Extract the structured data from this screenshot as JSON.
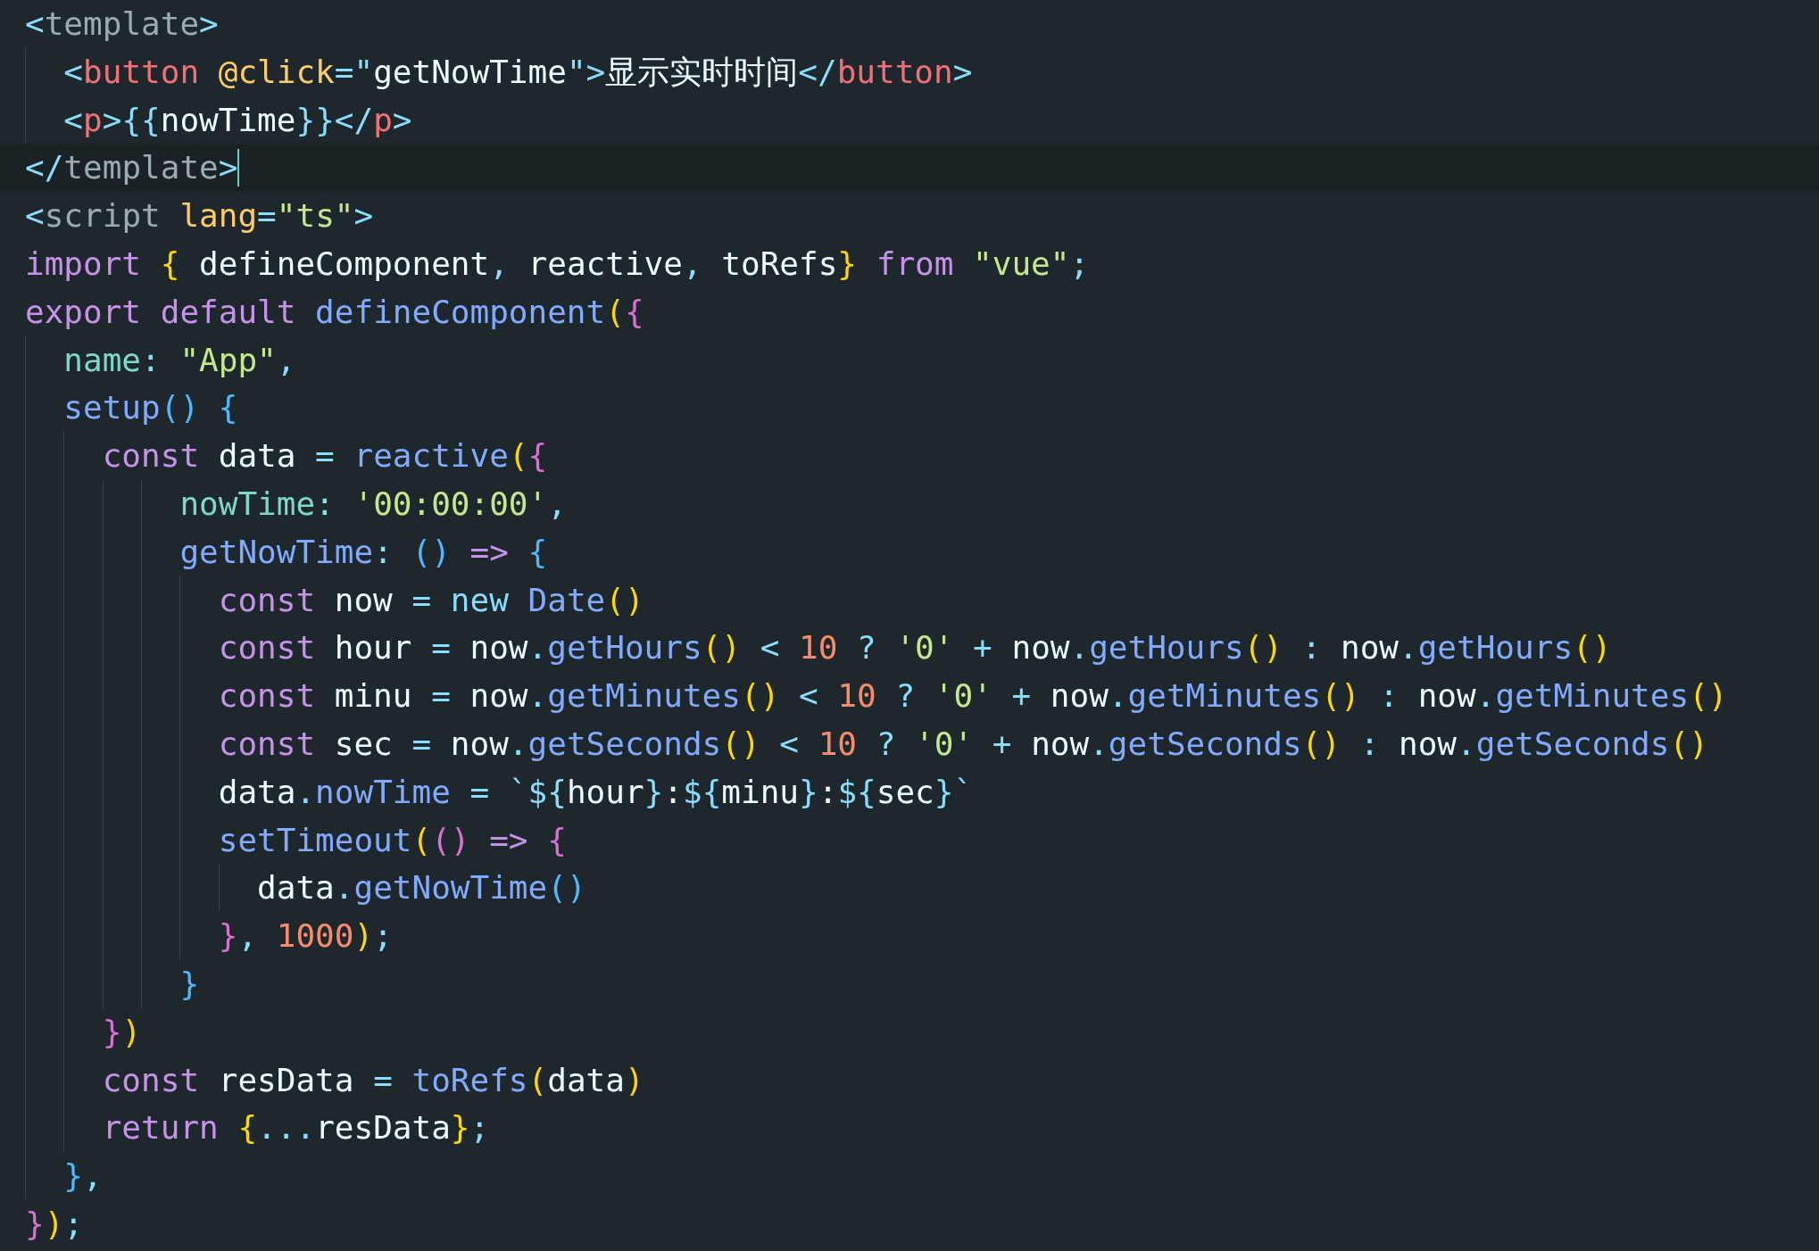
{
  "editor": {
    "lines": [
      {
        "current": false,
        "tokens": [
          {
            "text": "<",
            "kind": "p"
          },
          {
            "text": "template",
            "kind": "tagname"
          },
          {
            "text": ">",
            "kind": "p"
          }
        ]
      },
      {
        "current": false,
        "tokens": [
          {
            "text": "  <",
            "kind": "p"
          },
          {
            "text": "button",
            "kind": "tag"
          },
          {
            "text": " @click",
            "kind": "attr"
          },
          {
            "text": "=\"",
            "kind": "p"
          },
          {
            "text": "getNowTime",
            "kind": "txt"
          },
          {
            "text": "\">",
            "kind": "p"
          },
          {
            "text": "显示实时时间",
            "kind": "txt"
          },
          {
            "text": "</",
            "kind": "p"
          },
          {
            "text": "button",
            "kind": "tag"
          },
          {
            "text": ">",
            "kind": "p"
          }
        ]
      },
      {
        "current": false,
        "tokens": [
          {
            "text": "  <",
            "kind": "p"
          },
          {
            "text": "p",
            "kind": "tag"
          },
          {
            "text": ">{{",
            "kind": "p"
          },
          {
            "text": "nowTime",
            "kind": "txt"
          },
          {
            "text": "}}</",
            "kind": "p"
          },
          {
            "text": "p",
            "kind": "tag"
          },
          {
            "text": ">",
            "kind": "p"
          }
        ]
      },
      {
        "current": true,
        "tokens": [
          {
            "text": "</",
            "kind": "p"
          },
          {
            "text": "template",
            "kind": "tagname"
          },
          {
            "text": ">",
            "kind": "p"
          }
        ]
      },
      {
        "current": false,
        "tokens": [
          {
            "text": "<",
            "kind": "p"
          },
          {
            "text": "script",
            "kind": "tagname"
          },
          {
            "text": " lang",
            "kind": "attr"
          },
          {
            "text": "=",
            "kind": "p"
          },
          {
            "text": "\"ts\"",
            "kind": "str"
          },
          {
            "text": ">",
            "kind": "p"
          }
        ]
      },
      {
        "current": false,
        "tokens": [
          {
            "text": "import",
            "kind": "kw"
          },
          {
            "text": " {",
            "kind": "by"
          },
          {
            "text": " defineComponent",
            "kind": "txt"
          },
          {
            "text": ",",
            "kind": "p"
          },
          {
            "text": " reactive",
            "kind": "txt"
          },
          {
            "text": ",",
            "kind": "p"
          },
          {
            "text": " toRefs",
            "kind": "txt"
          },
          {
            "text": "}",
            "kind": "by"
          },
          {
            "text": " from",
            "kind": "kw"
          },
          {
            "text": " \"vue\"",
            "kind": "str"
          },
          {
            "text": ";",
            "kind": "p"
          }
        ]
      },
      {
        "current": false,
        "tokens": [
          {
            "text": "export default",
            "kind": "kw"
          },
          {
            "text": " defineComponent",
            "kind": "fn"
          },
          {
            "text": "(",
            "kind": "by"
          },
          {
            "text": "{",
            "kind": "bp"
          }
        ]
      },
      {
        "current": false,
        "tokens": [
          {
            "text": "  name",
            "kind": "prop"
          },
          {
            "text": ":",
            "kind": "p"
          },
          {
            "text": " \"App\"",
            "kind": "str"
          },
          {
            "text": ",",
            "kind": "p"
          }
        ]
      },
      {
        "current": false,
        "tokens": [
          {
            "text": "  setup",
            "kind": "fn"
          },
          {
            "text": "()",
            "kind": "bb"
          },
          {
            "text": " {",
            "kind": "bb"
          }
        ]
      },
      {
        "current": false,
        "tokens": [
          {
            "text": "    const",
            "kind": "kw"
          },
          {
            "text": " data ",
            "kind": "txt"
          },
          {
            "text": "=",
            "kind": "op"
          },
          {
            "text": " reactive",
            "kind": "fn"
          },
          {
            "text": "(",
            "kind": "by"
          },
          {
            "text": "{",
            "kind": "bp"
          }
        ]
      },
      {
        "current": false,
        "tokens": [
          {
            "text": "        nowTime",
            "kind": "prop"
          },
          {
            "text": ":",
            "kind": "p"
          },
          {
            "text": " '00:00:00'",
            "kind": "str"
          },
          {
            "text": ",",
            "kind": "p"
          }
        ]
      },
      {
        "current": false,
        "tokens": [
          {
            "text": "        getNowTime",
            "kind": "fn"
          },
          {
            "text": ":",
            "kind": "p"
          },
          {
            "text": " ()",
            "kind": "bb"
          },
          {
            "text": " =>",
            "kind": "kw"
          },
          {
            "text": " {",
            "kind": "bb"
          }
        ]
      },
      {
        "current": false,
        "tokens": [
          {
            "text": "          const",
            "kind": "kw"
          },
          {
            "text": " now ",
            "kind": "txt"
          },
          {
            "text": "=",
            "kind": "op"
          },
          {
            "text": " new",
            "kind": "op"
          },
          {
            "text": " Date",
            "kind": "fn"
          },
          {
            "text": "()",
            "kind": "by"
          }
        ]
      },
      {
        "current": false,
        "tokens": [
          {
            "text": "          const",
            "kind": "kw"
          },
          {
            "text": " hour ",
            "kind": "txt"
          },
          {
            "text": "=",
            "kind": "op"
          },
          {
            "text": " now",
            "kind": "txt"
          },
          {
            "text": ".",
            "kind": "p"
          },
          {
            "text": "getHours",
            "kind": "fn"
          },
          {
            "text": "()",
            "kind": "by"
          },
          {
            "text": " <",
            "kind": "op"
          },
          {
            "text": " 10",
            "kind": "num"
          },
          {
            "text": " ?",
            "kind": "op"
          },
          {
            "text": " '0'",
            "kind": "str"
          },
          {
            "text": " +",
            "kind": "op"
          },
          {
            "text": " now",
            "kind": "txt"
          },
          {
            "text": ".",
            "kind": "p"
          },
          {
            "text": "getHours",
            "kind": "fn"
          },
          {
            "text": "()",
            "kind": "by"
          },
          {
            "text": " :",
            "kind": "op"
          },
          {
            "text": " now",
            "kind": "txt"
          },
          {
            "text": ".",
            "kind": "p"
          },
          {
            "text": "getHours",
            "kind": "fn"
          },
          {
            "text": "()",
            "kind": "by"
          }
        ]
      },
      {
        "current": false,
        "tokens": [
          {
            "text": "          const",
            "kind": "kw"
          },
          {
            "text": " minu ",
            "kind": "txt"
          },
          {
            "text": "=",
            "kind": "op"
          },
          {
            "text": " now",
            "kind": "txt"
          },
          {
            "text": ".",
            "kind": "p"
          },
          {
            "text": "getMinutes",
            "kind": "fn"
          },
          {
            "text": "()",
            "kind": "by"
          },
          {
            "text": " <",
            "kind": "op"
          },
          {
            "text": " 10",
            "kind": "num"
          },
          {
            "text": " ?",
            "kind": "op"
          },
          {
            "text": " '0'",
            "kind": "str"
          },
          {
            "text": " +",
            "kind": "op"
          },
          {
            "text": " now",
            "kind": "txt"
          },
          {
            "text": ".",
            "kind": "p"
          },
          {
            "text": "getMinutes",
            "kind": "fn"
          },
          {
            "text": "()",
            "kind": "by"
          },
          {
            "text": " :",
            "kind": "op"
          },
          {
            "text": " now",
            "kind": "txt"
          },
          {
            "text": ".",
            "kind": "p"
          },
          {
            "text": "getMinutes",
            "kind": "fn"
          },
          {
            "text": "()",
            "kind": "by"
          }
        ]
      },
      {
        "current": false,
        "tokens": [
          {
            "text": "          const",
            "kind": "kw"
          },
          {
            "text": " sec ",
            "kind": "txt"
          },
          {
            "text": "=",
            "kind": "op"
          },
          {
            "text": " now",
            "kind": "txt"
          },
          {
            "text": ".",
            "kind": "p"
          },
          {
            "text": "getSeconds",
            "kind": "fn"
          },
          {
            "text": "()",
            "kind": "by"
          },
          {
            "text": " <",
            "kind": "op"
          },
          {
            "text": " 10",
            "kind": "num"
          },
          {
            "text": " ?",
            "kind": "op"
          },
          {
            "text": " '0'",
            "kind": "str"
          },
          {
            "text": " +",
            "kind": "op"
          },
          {
            "text": " now",
            "kind": "txt"
          },
          {
            "text": ".",
            "kind": "p"
          },
          {
            "text": "getSeconds",
            "kind": "fn"
          },
          {
            "text": "()",
            "kind": "by"
          },
          {
            "text": " :",
            "kind": "op"
          },
          {
            "text": " now",
            "kind": "txt"
          },
          {
            "text": ".",
            "kind": "p"
          },
          {
            "text": "getSeconds",
            "kind": "fn"
          },
          {
            "text": "()",
            "kind": "by"
          }
        ]
      },
      {
        "current": false,
        "tokens": [
          {
            "text": "          data",
            "kind": "txt"
          },
          {
            "text": ".",
            "kind": "p"
          },
          {
            "text": "nowTime",
            "kind": "fn"
          },
          {
            "text": " =",
            "kind": "op"
          },
          {
            "text": " `${",
            "kind": "op"
          },
          {
            "text": "hour",
            "kind": "txt"
          },
          {
            "text": "}",
            "kind": "op"
          },
          {
            "text": ":",
            "kind": "txt"
          },
          {
            "text": "${",
            "kind": "op"
          },
          {
            "text": "minu",
            "kind": "txt"
          },
          {
            "text": "}",
            "kind": "op"
          },
          {
            "text": ":",
            "kind": "txt"
          },
          {
            "text": "${",
            "kind": "op"
          },
          {
            "text": "sec",
            "kind": "txt"
          },
          {
            "text": "}`",
            "kind": "op"
          }
        ]
      },
      {
        "current": false,
        "tokens": [
          {
            "text": "          setTimeout",
            "kind": "fn"
          },
          {
            "text": "(",
            "kind": "by"
          },
          {
            "text": "()",
            "kind": "bp"
          },
          {
            "text": " =>",
            "kind": "kw"
          },
          {
            "text": " {",
            "kind": "bp"
          }
        ]
      },
      {
        "current": false,
        "tokens": [
          {
            "text": "            data",
            "kind": "txt"
          },
          {
            "text": ".",
            "kind": "p"
          },
          {
            "text": "getNowTime",
            "kind": "fn"
          },
          {
            "text": "()",
            "kind": "bb"
          }
        ]
      },
      {
        "current": false,
        "tokens": [
          {
            "text": "          }",
            "kind": "bp"
          },
          {
            "text": ",",
            "kind": "p"
          },
          {
            "text": " 1000",
            "kind": "num"
          },
          {
            "text": ")",
            "kind": "by"
          },
          {
            "text": ";",
            "kind": "p"
          }
        ]
      },
      {
        "current": false,
        "tokens": [
          {
            "text": "        }",
            "kind": "bb"
          }
        ]
      },
      {
        "current": false,
        "tokens": [
          {
            "text": "    }",
            "kind": "bp"
          },
          {
            "text": ")",
            "kind": "by"
          }
        ]
      },
      {
        "current": false,
        "tokens": [
          {
            "text": "    const",
            "kind": "kw"
          },
          {
            "text": " resData ",
            "kind": "txt"
          },
          {
            "text": "=",
            "kind": "op"
          },
          {
            "text": " toRefs",
            "kind": "fn"
          },
          {
            "text": "(",
            "kind": "by"
          },
          {
            "text": "data",
            "kind": "txt"
          },
          {
            "text": ")",
            "kind": "by"
          }
        ]
      },
      {
        "current": false,
        "tokens": [
          {
            "text": "    return",
            "kind": "kw"
          },
          {
            "text": " {",
            "kind": "by"
          },
          {
            "text": "...",
            "kind": "p"
          },
          {
            "text": "resData",
            "kind": "txt"
          },
          {
            "text": "}",
            "kind": "by"
          },
          {
            "text": ";",
            "kind": "p"
          }
        ]
      },
      {
        "current": false,
        "tokens": [
          {
            "text": "  }",
            "kind": "bb"
          },
          {
            "text": ",",
            "kind": "p"
          }
        ]
      },
      {
        "current": false,
        "tokens": [
          {
            "text": "}",
            "kind": "bp"
          },
          {
            "text": ")",
            "kind": "by"
          },
          {
            "text": ";",
            "kind": "p"
          }
        ]
      }
    ]
  }
}
